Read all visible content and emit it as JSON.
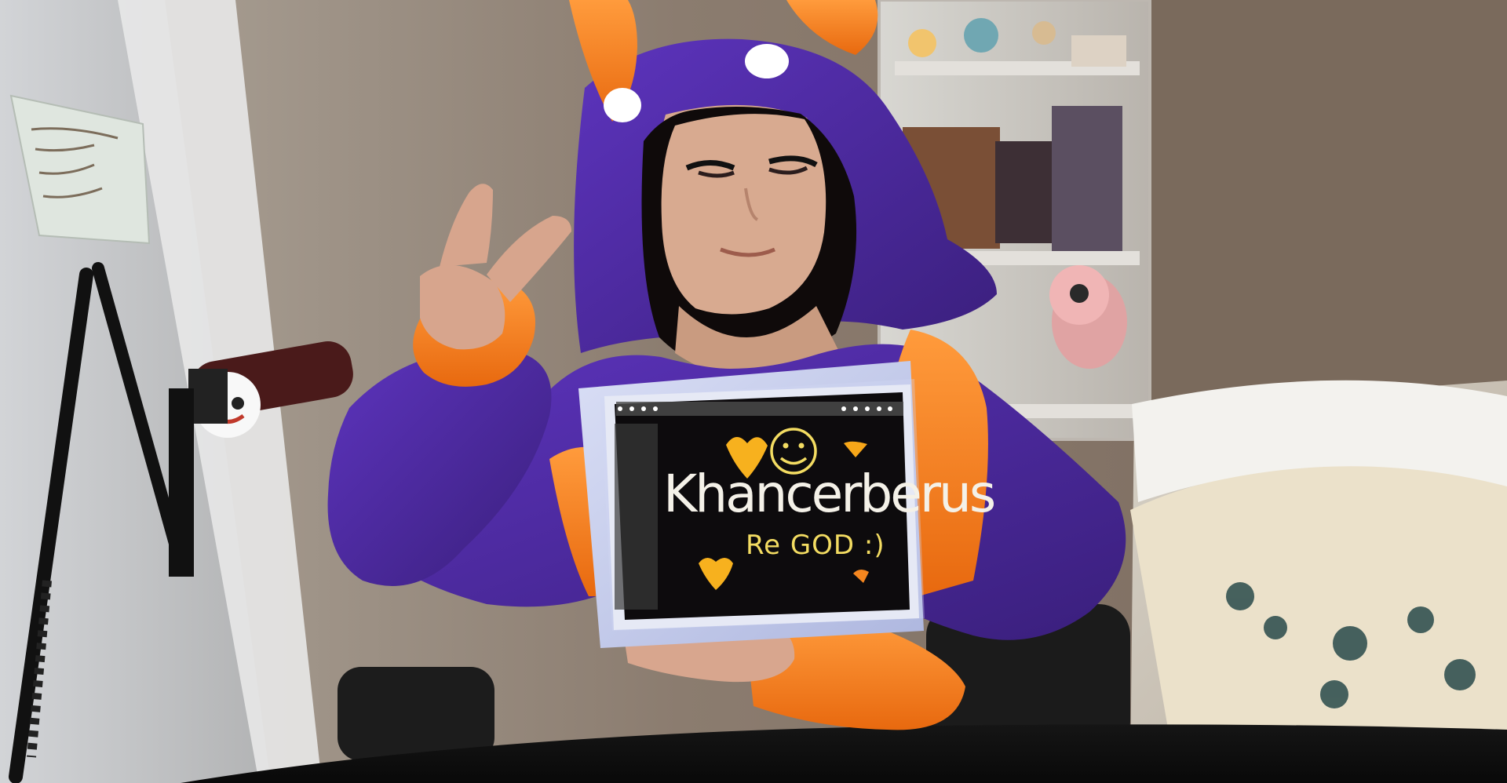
{
  "tablet": {
    "headline": "Khancerberus",
    "subline": "Re GOD :)"
  },
  "colors": {
    "wall": "#8a7a6b",
    "hoodie_purple": "#4b2a9a",
    "hoodie_orange": "#f07a1a",
    "tablet_screen": "#0d0b0d",
    "tablet_case": "#b7c0e5",
    "heart_orange": "#f7b11e"
  },
  "icons": {
    "smiley": "smiley-face-icon",
    "heart": "heart-icon",
    "mic": "microphone-icon"
  }
}
